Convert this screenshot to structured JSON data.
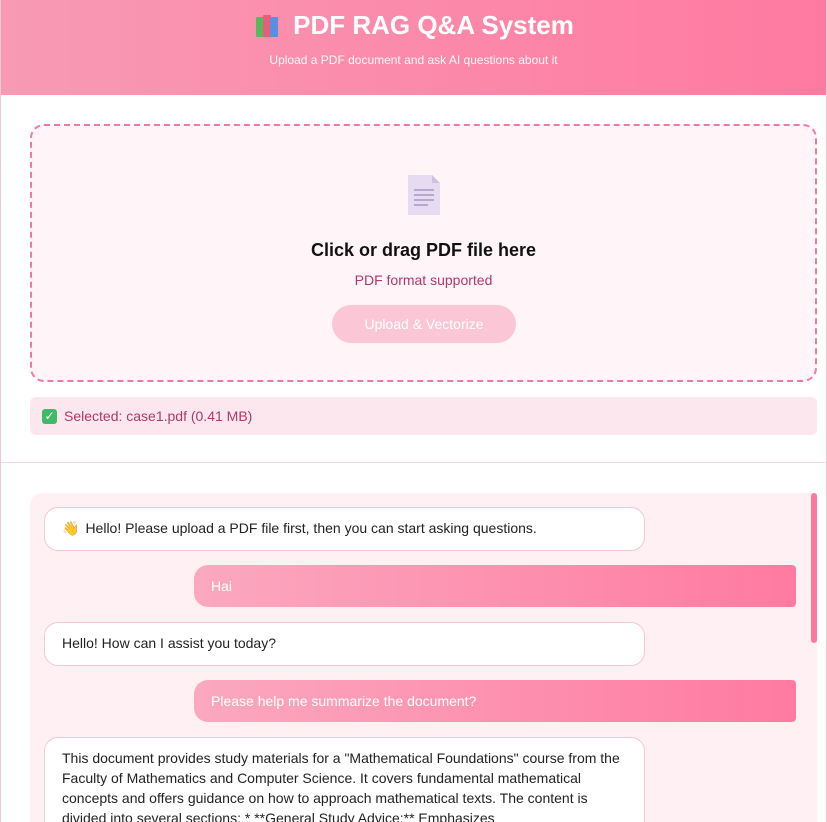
{
  "header": {
    "title": "PDF RAG Q&A System",
    "subtitle": "Upload a PDF document and ask AI questions about it",
    "icon": "books-icon"
  },
  "upload": {
    "drop_title": "Click or drag PDF file here",
    "drop_hint": "PDF format supported",
    "button_label": "Upload & Vectorize",
    "selected_text": "Selected: case1.pdf (0.41 MB)"
  },
  "chat": {
    "messages": [
      {
        "role": "bot",
        "text": "Hello! Please upload a PDF file first, then you can start asking questions.",
        "icon": "waving-hand-icon"
      },
      {
        "role": "user",
        "text": "Hai"
      },
      {
        "role": "bot",
        "text": "Hello! How can I assist you today?"
      },
      {
        "role": "user",
        "text": "Please help me summarize the document?"
      },
      {
        "role": "bot",
        "text": "This document provides study materials for a \"Mathematical Foundations\" course from the Faculty of Mathematics and Computer Science. It covers fundamental mathematical concepts and offers guidance on how to approach mathematical texts. The content is divided into several sections: * **General Study Advice:** Emphasizes"
      }
    ]
  },
  "colors": {
    "accent": "#ff7aa0",
    "accent_light": "#fbc6d6",
    "panel_bg": "#fff0f4",
    "hint_text": "#b0386b"
  }
}
